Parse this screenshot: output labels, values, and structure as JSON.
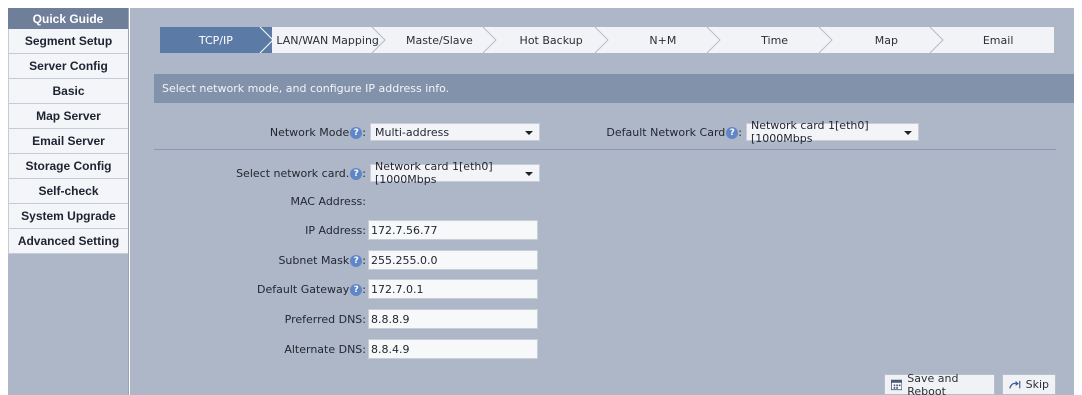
{
  "sidebar": {
    "items": [
      {
        "label": "Quick Guide"
      },
      {
        "label": "Segment Setup"
      },
      {
        "label": "Server Config"
      },
      {
        "label": "Basic"
      },
      {
        "label": "Map Server"
      },
      {
        "label": "Email Server"
      },
      {
        "label": "Storage Config"
      },
      {
        "label": "Self-check"
      },
      {
        "label": "System Upgrade"
      },
      {
        "label": "Advanced Setting"
      }
    ]
  },
  "steps": [
    {
      "label": "TCP/IP",
      "active": true
    },
    {
      "label": "LAN/WAN Mapping"
    },
    {
      "label": "Maste/Slave"
    },
    {
      "label": "Hot Backup"
    },
    {
      "label": "N+M"
    },
    {
      "label": "Time"
    },
    {
      "label": "Map"
    },
    {
      "label": "Email"
    }
  ],
  "info_text": "Select network mode, and configure IP address info.",
  "form": {
    "network_mode": {
      "label": "Network Mode",
      "suffix": ":",
      "value": "Multi-address"
    },
    "default_card": {
      "label": "Default Network Card",
      "suffix": ":",
      "value": "Network card 1[eth0] [1000Mbps"
    },
    "select_card": {
      "label": "Select network card.",
      "suffix": ":",
      "value": "Network card 1[eth0] [1000Mbps"
    },
    "mac": {
      "label": "MAC Address:",
      "value": ""
    },
    "ip": {
      "label": "IP Address:",
      "value": "172.7.56.77"
    },
    "subnet": {
      "label": "Subnet Mask",
      "suffix": ":",
      "value": "255.255.0.0"
    },
    "gateway": {
      "label": "Default Gateway",
      "suffix": ":",
      "value": "172.7.0.1"
    },
    "pdns": {
      "label": "Preferred DNS:",
      "value": "8.8.8.9"
    },
    "adns": {
      "label": "Alternate DNS:",
      "value": "8.8.4.9"
    }
  },
  "buttons": {
    "save_reboot": "Save and Reboot",
    "skip": "Skip"
  },
  "icons": {
    "help": "question-circle-icon",
    "save": "save-calendar-icon",
    "skip": "skip-arrow-icon"
  },
  "help_glyph": "?",
  "colors": {
    "active_tab": "#5b7aa6",
    "sidebar_header": "#6f7f9a",
    "info_bar": "#8392ab",
    "panel_bg": "#aeb7c7"
  }
}
